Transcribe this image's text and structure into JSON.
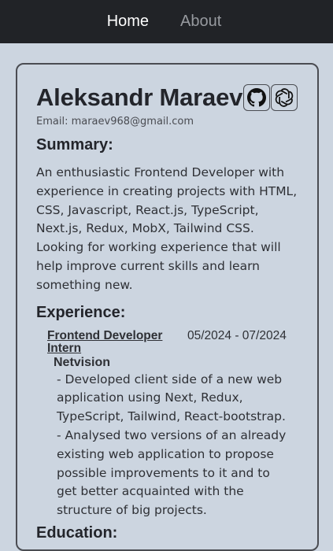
{
  "nav": {
    "home": "Home",
    "about": "About"
  },
  "profile": {
    "name": "Aleksandr Maraev",
    "email": "Email: maraev968@gmail.com",
    "icons": [
      "github-icon",
      "openai-icon"
    ]
  },
  "summary": {
    "title": "Summary:",
    "text": "An enthusiastic Frontend Developer with experience in creating projects with HTML, CSS, Javascript, React.js, TypeScript, Next.js, Redux, MobX, Tailwind CSS. Looking for working experience that will help improve current skills and learn something new."
  },
  "experience": {
    "title": "Experience:",
    "items": [
      {
        "role": "Frontend Developer Intern",
        "dates": "05/2024 - 07/2024",
        "company": "Netvision",
        "bullets": [
          "- Developed client side of a new web application using Next, Redux, TypeScript, Tailwind, React-bootstrap.",
          "- Analysed two versions of an already existing web application to propose possible improvements to it and to get better acquainted with the structure of big projects."
        ]
      }
    ]
  },
  "education": {
    "title": "Education:"
  },
  "colors": {
    "navbar": "#212327",
    "page_bg": "#ccd5e0",
    "text": "#23252b",
    "nav_inactive": "#979a9f"
  }
}
